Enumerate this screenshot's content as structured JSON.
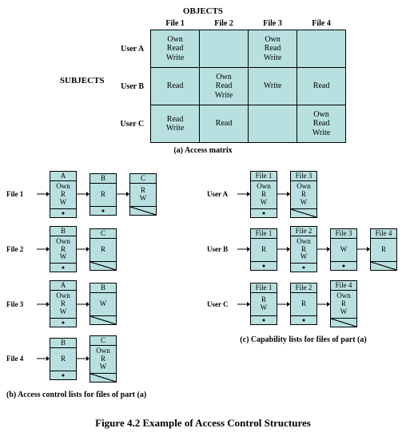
{
  "matrix": {
    "objects_label": "OBJECTS",
    "subjects_label": "SUBJECTS",
    "col_headers": [
      "File 1",
      "File 2",
      "File 3",
      "File 4"
    ],
    "rows": [
      {
        "label": "User A",
        "cells": [
          "Own\nRead\nWrite",
          "",
          "Own\nRead\nWrite",
          ""
        ]
      },
      {
        "label": "User B",
        "cells": [
          "Read",
          "Own\nRead\nWrite",
          "Write",
          "Read"
        ]
      },
      {
        "label": "User C",
        "cells": [
          "Read\nWrite",
          "Read",
          "",
          "Own\nRead\nWrite"
        ]
      }
    ],
    "caption": "(a) Access matrix"
  },
  "acl": {
    "chains": [
      {
        "label": "File 1",
        "nodes": [
          {
            "head": "A",
            "body": "Own\nR\nW",
            "last": false
          },
          {
            "head": "B",
            "body": "R",
            "last": false
          },
          {
            "head": "C",
            "body": "R\nW",
            "last": true
          }
        ]
      },
      {
        "label": "File 2",
        "nodes": [
          {
            "head": "B",
            "body": "Own\nR\nW",
            "last": false
          },
          {
            "head": "C",
            "body": "R",
            "last": true
          }
        ]
      },
      {
        "label": "File 3",
        "nodes": [
          {
            "head": "A",
            "body": "Own\nR\nW",
            "last": false
          },
          {
            "head": "B",
            "body": "W",
            "last": true
          }
        ]
      },
      {
        "label": "File 4",
        "nodes": [
          {
            "head": "B",
            "body": "R",
            "last": false
          },
          {
            "head": "C",
            "body": "Own\nR\nW",
            "last": true
          }
        ]
      }
    ],
    "caption": "(b) Access control lists for files of part (a)"
  },
  "cap": {
    "chains": [
      {
        "label": "User A",
        "nodes": [
          {
            "head": "File 1",
            "body": "Own\nR\nW",
            "last": false
          },
          {
            "head": "File 3",
            "body": "Own\nR\nW",
            "last": true
          }
        ]
      },
      {
        "label": "User B",
        "nodes": [
          {
            "head": "File 1",
            "body": "R",
            "last": false
          },
          {
            "head": "File 2",
            "body": "Own\nR\nW",
            "last": false
          },
          {
            "head": "File 3",
            "body": "W",
            "last": false
          },
          {
            "head": "File 4",
            "body": "R",
            "last": true
          }
        ]
      },
      {
        "label": "User C",
        "nodes": [
          {
            "head": "File 1",
            "body": "R\nW",
            "last": false
          },
          {
            "head": "File 2",
            "body": "R",
            "last": false
          },
          {
            "head": "File 4",
            "body": "Own\nR\nW",
            "last": true
          }
        ]
      }
    ],
    "caption": "(c) Capability lists for files of part (a)"
  },
  "figure_title": "Figure 4.2  Example of Access Control Structures"
}
